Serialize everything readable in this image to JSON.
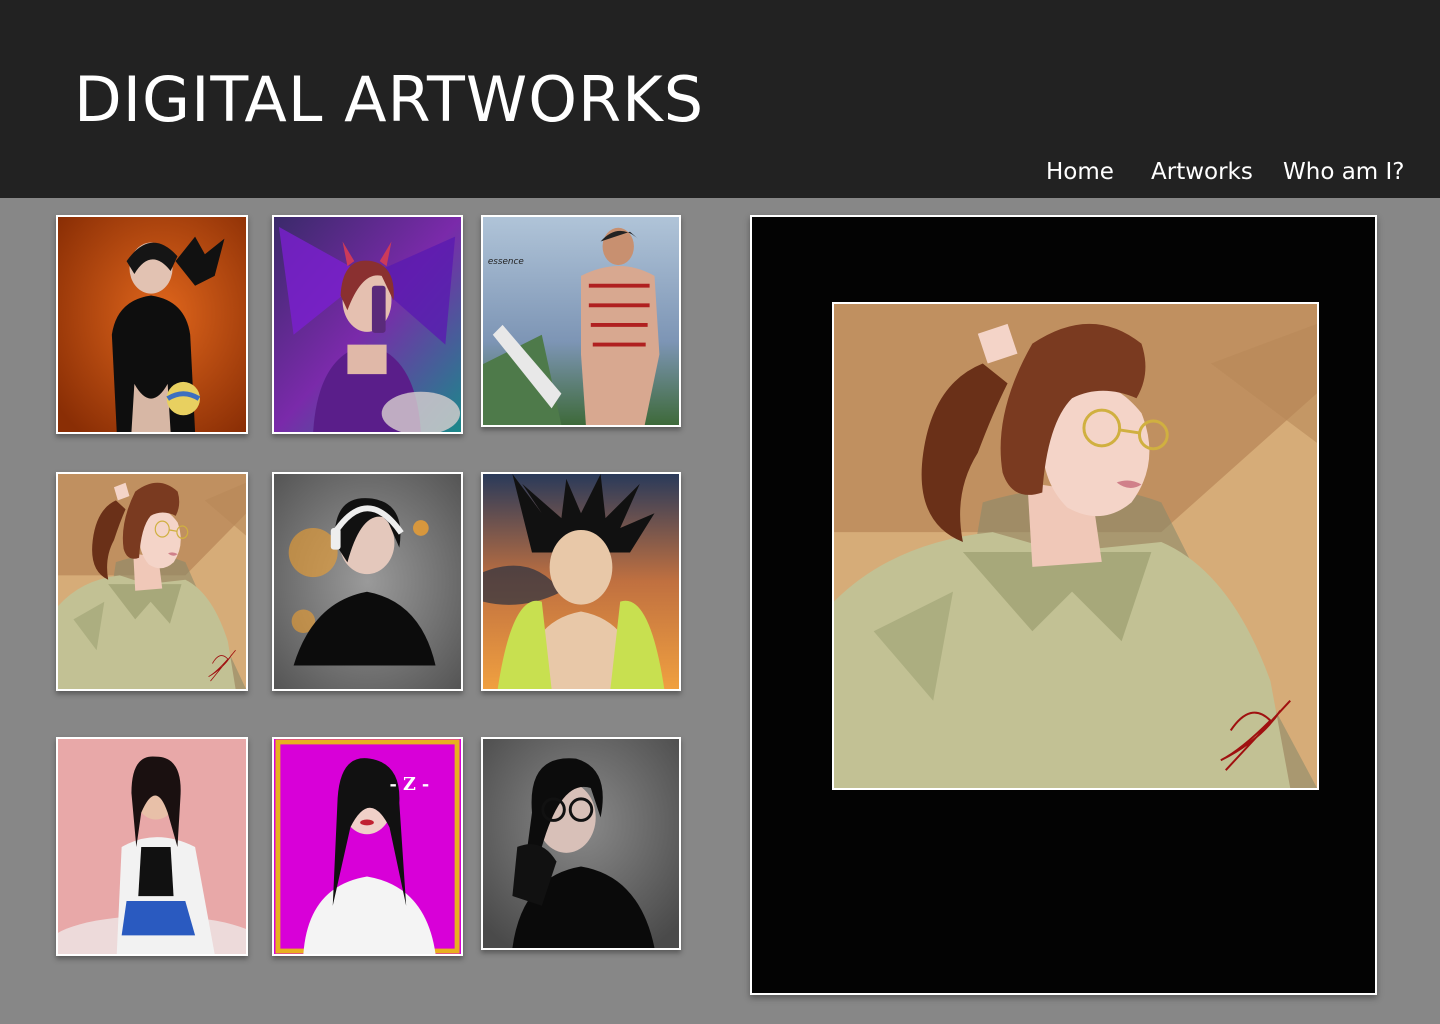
{
  "header": {
    "title": "DIGITAL ARTWORKS"
  },
  "nav": {
    "items": [
      {
        "label": "Home"
      },
      {
        "label": "Artworks"
      },
      {
        "label": "Who am I?"
      }
    ]
  },
  "gallery": {
    "items": [
      {
        "subject": "portrait with crow and volleyball",
        "icon": "artwork-thumbnail",
        "accent": "#c54a10"
      },
      {
        "subject": "fairy with horns taking selfie",
        "icon": "artwork-thumbnail",
        "accent": "#6a2a9a"
      },
      {
        "subject": "tattooed warrior with sword",
        "icon": "artwork-thumbnail",
        "accent": "#6c8fbf",
        "caption": "essence"
      },
      {
        "subject": "girl with glasses and ponytail",
        "icon": "artwork-thumbnail",
        "accent": "#d9b07a"
      },
      {
        "subject": "boy with headphones",
        "icon": "artwork-thumbnail",
        "accent": "#666666"
      },
      {
        "subject": "spiky haired character at sunset",
        "icon": "artwork-thumbnail",
        "accent": "#e0883a"
      },
      {
        "subject": "woman in white coat",
        "icon": "artwork-thumbnail",
        "accent": "#e8a8a8"
      },
      {
        "subject": "girl in white blouse on magenta",
        "icon": "artwork-thumbnail",
        "accent": "#cc00cc",
        "caption": "- Z -"
      },
      {
        "subject": "woman with round glasses",
        "icon": "artwork-thumbnail",
        "accent": "#555555"
      }
    ]
  },
  "viewer": {
    "subject": "girl with glasses and ponytail",
    "icon": "featured-artwork"
  },
  "colors": {
    "header_bg": "#222222",
    "page_bg": "#878787",
    "viewer_bg": "#030303",
    "border": "#ffffff"
  }
}
